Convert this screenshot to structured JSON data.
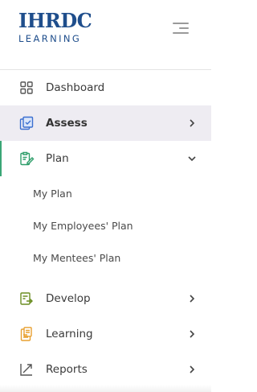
{
  "logo": {
    "main": "IHRDC",
    "sub": "LEARNING"
  },
  "nav": {
    "dashboard": "Dashboard",
    "assess": "Assess",
    "plan": "Plan",
    "develop": "Develop",
    "learning": "Learning",
    "reports": "Reports"
  },
  "plan_submenu": {
    "my_plan": "My Plan",
    "employees_plan": "My Employees' Plan",
    "mentees_plan": "My Mentees' Plan"
  },
  "colors": {
    "brand_blue": "#1f4e8c",
    "active_bg": "#eeecf2",
    "open_indicator": "#3aa676",
    "icon_assess": "#3b6fd0",
    "icon_plan": "#2e9e6a",
    "icon_develop": "#6b8e23",
    "icon_learning": "#e8a030"
  },
  "icons": {
    "dashboard": "grid-icon",
    "assess": "checklist-icon",
    "plan": "plan-edit-icon",
    "develop": "develop-icon",
    "learning": "clipboard-icon",
    "reports": "trend-chart-icon"
  }
}
